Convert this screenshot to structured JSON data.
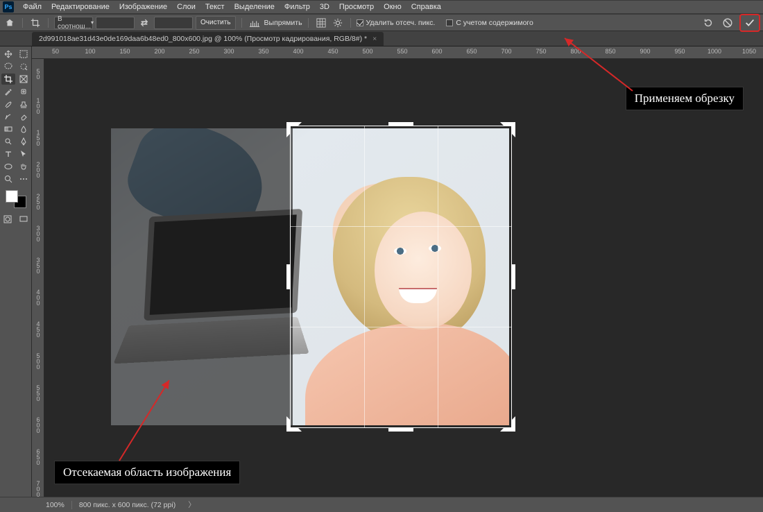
{
  "app": {
    "logo": "Ps"
  },
  "menu": [
    "Файл",
    "Редактирование",
    "Изображение",
    "Слои",
    "Текст",
    "Выделение",
    "Фильтр",
    "3D",
    "Просмотр",
    "Окно",
    "Справка"
  ],
  "options": {
    "ratio_mode": "В соотнош...",
    "clear": "Очистить",
    "straighten": "Выпрямить",
    "delete_cropped": {
      "checked": true,
      "label": "Удалить отсеч. пикс."
    },
    "content_aware": {
      "checked": false,
      "label": "С учетом содержимого"
    }
  },
  "doc": {
    "tab": "2d991018ae31d43e0de169daa6b48ed0_800x600.jpg @ 100% (Просмотр кадрирования, RGB/8#) *"
  },
  "rulers": {
    "h": [
      "50",
      "100",
      "150",
      "200",
      "250",
      "300",
      "350",
      "400",
      "450",
      "500",
      "550",
      "600",
      "650",
      "700",
      "750",
      "800",
      "850",
      "900",
      "950",
      "1000",
      "1050"
    ],
    "v": [
      "50",
      "100",
      "150",
      "200",
      "250",
      "300",
      "350",
      "400",
      "450",
      "500",
      "550",
      "600",
      "650",
      "700"
    ]
  },
  "status": {
    "zoom": "100%",
    "info": "800 пикс. x 600 пикс. (72 ppi)"
  },
  "annotations": {
    "apply": "Применяем обрезку",
    "discard": "Отсекаемая область изображения"
  }
}
